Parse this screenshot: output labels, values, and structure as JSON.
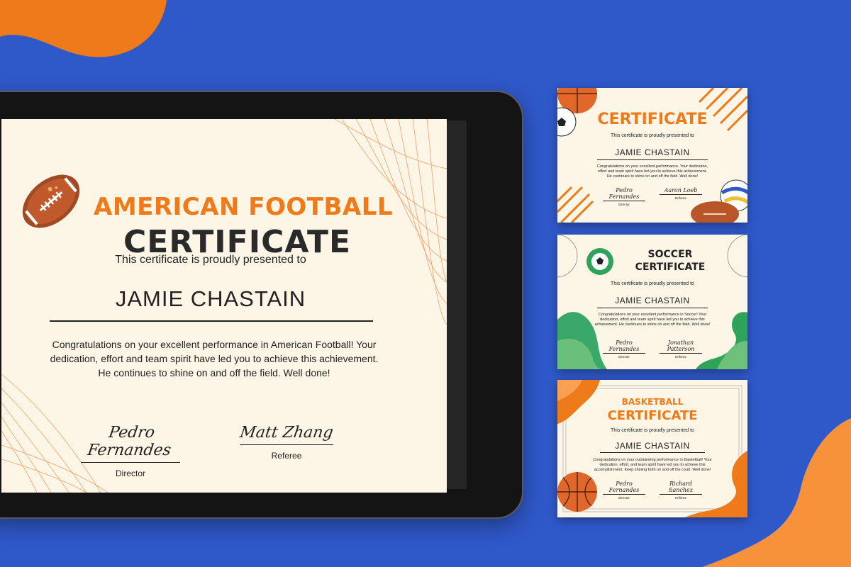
{
  "colors": {
    "background": "#2f58c9",
    "accent_orange": "#ef7a1a",
    "cream": "#fdf6e6",
    "green": "#2fa35a"
  },
  "main_certificate": {
    "title_line1": "AMERICAN FOOTBALL",
    "title_line2": "CERTIFICATE",
    "presented": "This certificate is proudly presented to",
    "name": "JAMIE CHASTAIN",
    "body": "Congratulations on your excellent performance in American Football! Your dedication, effort and team spirit have led you to achieve this achievement. He continues to shine on and off the field. Well done!",
    "signatures": [
      {
        "name": "Pedro Fernandes",
        "role": "Director"
      },
      {
        "name": "Matt Zhang",
        "role": "Referee"
      }
    ],
    "icon": "american-football-icon"
  },
  "cards": [
    {
      "title": "CERTIFICATE",
      "presented": "This certificate is proudly presented to",
      "name": "JAMIE CHASTAIN",
      "body": "Congratulations on your excellent performance. Your dedication, effort and team spirit have led you to achieve this achievement. He continues to shine on and off the field. Well done!",
      "signatures": [
        {
          "name": "Pedro Fernandes",
          "role": "Director"
        },
        {
          "name": "Aaron Loeb",
          "role": "Referee"
        }
      ]
    },
    {
      "title_line1": "SOCCER",
      "title_line2": "CERTIFICATE",
      "presented": "This certificate is proudly presented to",
      "name": "JAMIE CHASTAIN",
      "body": "Congratulations on your excellent performance in Soccer! Your dedication, effort and team spirit have led you to achieve this achievement. He continues to shine on and off the field. Well done!",
      "signatures": [
        {
          "name": "Pedro Fernandes",
          "role": "Director"
        },
        {
          "name": "Jonathan Patterson",
          "role": "Referee"
        }
      ]
    },
    {
      "title_line1": "BASKETBALL",
      "title_line2": "CERTIFICATE",
      "presented": "This certificate is proudly presented to",
      "name": "JAMIE CHASTAIN",
      "body": "Congratulations on your outstanding performance in Basketball! Your dedication, effort, and team spirit have led you to achieve this accomplishment. Keep shining both on and off the court. Well done!",
      "signatures": [
        {
          "name": "Pedro Fernandes",
          "role": "Director"
        },
        {
          "name": "Richard Sanchez",
          "role": "Referee"
        }
      ]
    }
  ]
}
